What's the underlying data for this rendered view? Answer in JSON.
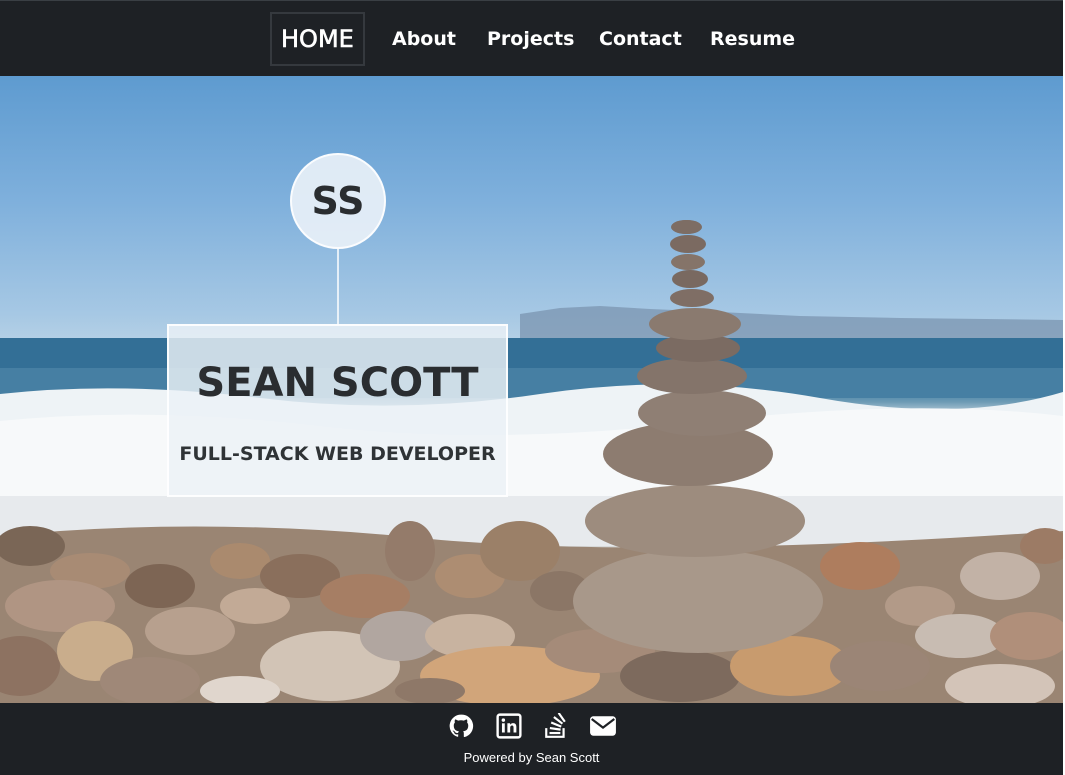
{
  "nav": {
    "items": [
      {
        "label": "HOME",
        "active": true
      },
      {
        "label": "About"
      },
      {
        "label": "Projects"
      },
      {
        "label": "Contact"
      },
      {
        "label": "Resume"
      }
    ]
  },
  "hero": {
    "initials": "SS",
    "name": "SEAN SCOTT",
    "title": "FULL-STACK WEB DEVELOPER",
    "background": "beach-stacked-stones-photo"
  },
  "footer": {
    "icons": [
      "github-icon",
      "linkedin-icon",
      "stackoverflow-icon",
      "envelope-icon"
    ],
    "credit": "Powered by Sean Scott"
  },
  "colors": {
    "nav_bg": "#1e2125",
    "card_bg": "#ecf2f7",
    "text_dark": "#2a2d30"
  }
}
